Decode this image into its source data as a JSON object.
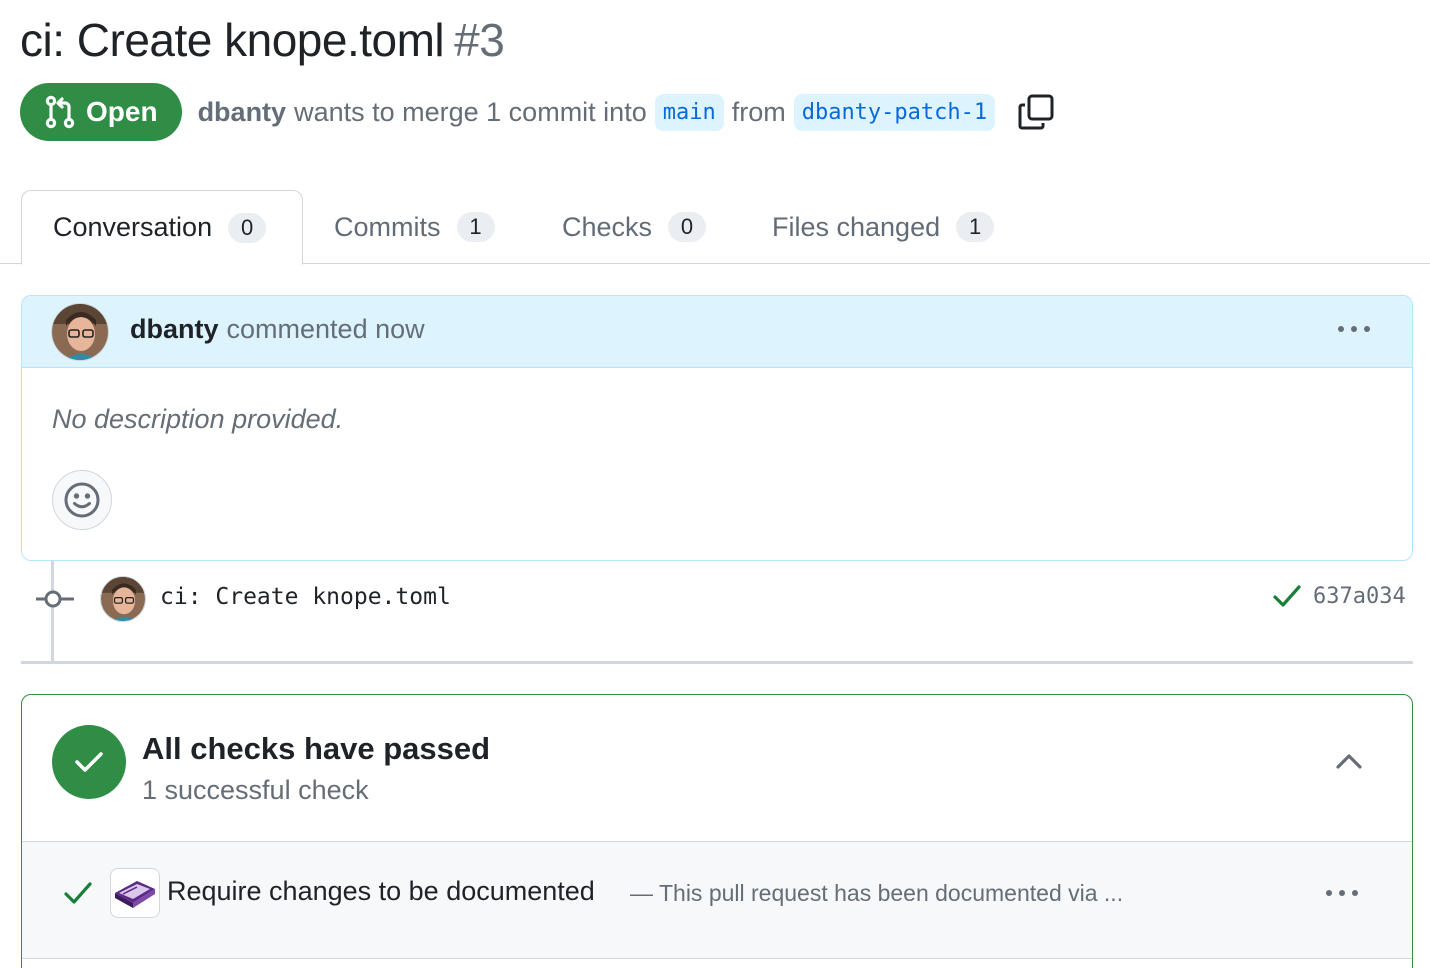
{
  "pr": {
    "title": "ci: Create knope.toml",
    "number": "#3",
    "state": "Open",
    "author": "dbanty",
    "merge_text": "wants to merge 1 commit into",
    "base_branch": "main",
    "from_text": "from",
    "head_branch": "dbanty-patch-1"
  },
  "tabs": [
    {
      "label": "Conversation",
      "count": "0"
    },
    {
      "label": "Commits",
      "count": "1"
    },
    {
      "label": "Checks",
      "count": "0"
    },
    {
      "label": "Files changed",
      "count": "1"
    }
  ],
  "comment": {
    "author": "dbanty",
    "action": "commented now",
    "body": "No description provided."
  },
  "commit": {
    "message": "ci: Create knope.toml",
    "sha": "637a034"
  },
  "checks": {
    "title": "All checks have passed",
    "subtitle": "1 successful check",
    "items": [
      {
        "name": "Require changes to be documented",
        "description": "— This pull request has been documented via ..."
      }
    ]
  },
  "colors": {
    "open_green": "#2f8d46",
    "link_blue": "#0969da",
    "branch_bg": "#ddf4ff",
    "comment_header_bg": "#ddf4ff"
  }
}
